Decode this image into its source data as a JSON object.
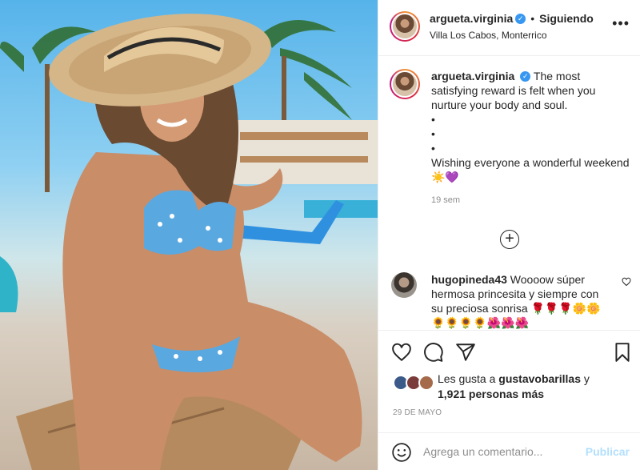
{
  "post": {
    "username": "argueta.virginia",
    "follow_status": "Siguiendo",
    "location": "Villa Los Cabos, Monterrico",
    "more_label": "•••"
  },
  "caption": {
    "username": "argueta.virginia",
    "text": "The most satisfying reward is felt when you nurture your body and soul.",
    "bullets": [
      "•",
      "•",
      "•"
    ],
    "closing": "Wishing everyone a wonderful weekend☀️💜",
    "time_ago": "19 sem"
  },
  "comment": {
    "username": "hugopineda43",
    "text": "Woooow súper hermosa princesita y siempre con su preciosa sonrisa 🌹🌹🌹🌼🌼🌻🌻🌻🌻🌺🌺🌺"
  },
  "likes": {
    "prefix": "Les gusta a",
    "liker": "gustavobarillas",
    "conjunction": "y",
    "others": "1,921 personas más"
  },
  "date": "29 DE MAYO",
  "add_comment": {
    "placeholder": "Agrega un comentario...",
    "post_label": "Publicar"
  },
  "icons": {
    "verified": "verified-badge-icon",
    "like": "heart-icon",
    "comment": "comment-icon",
    "share": "share-icon",
    "save": "bookmark-icon",
    "emoji": "smile-icon",
    "load_more": "plus-circle-icon",
    "comment_like": "heart-icon"
  },
  "colors": {
    "accent": "#3897f0",
    "post_disabled": "#b2dffc",
    "muted": "#8e8e8e"
  }
}
